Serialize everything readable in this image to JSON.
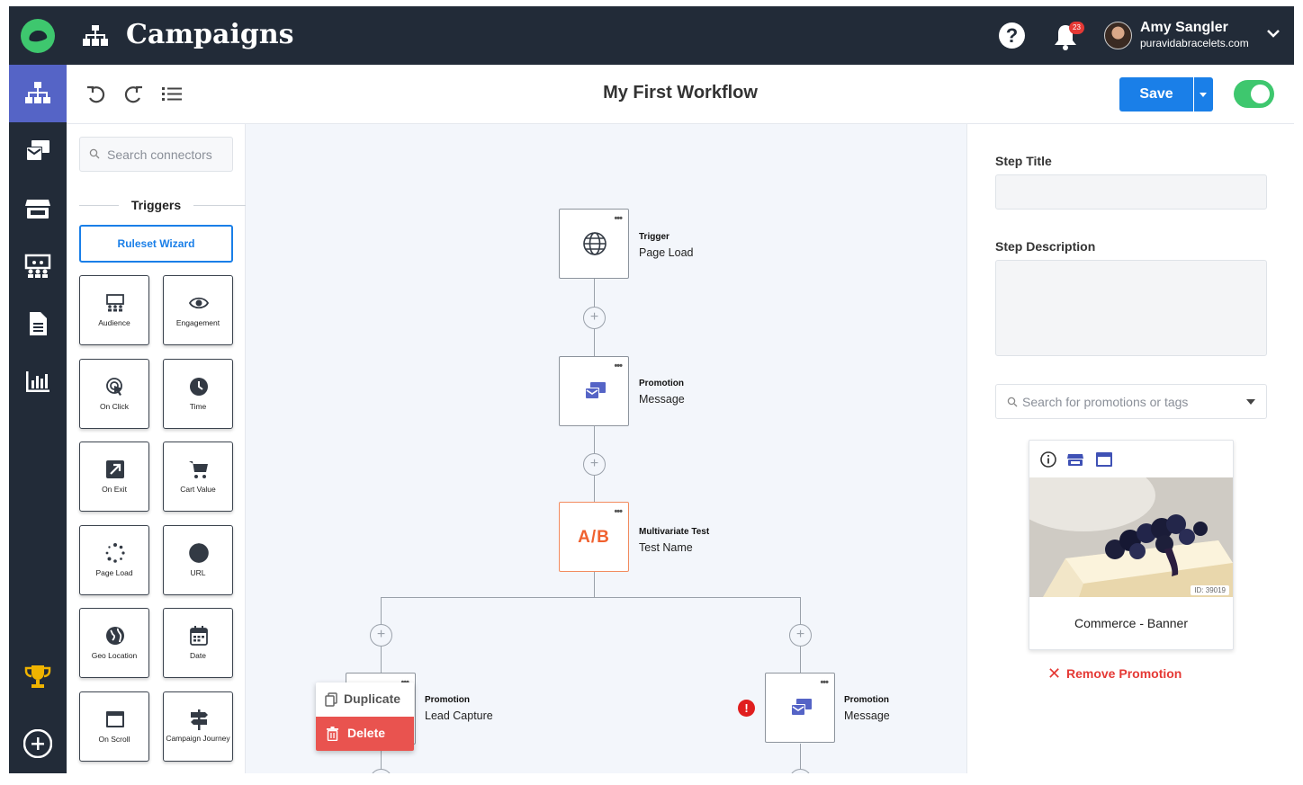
{
  "header": {
    "app_title": "Campaigns",
    "notification_count": "23",
    "user_name": "Amy Sangler",
    "user_domain": "puravidabracelets.com",
    "help_glyph": "?"
  },
  "rail": {
    "items": [
      "workflow-icon",
      "promotions-icon",
      "store-icon",
      "audience-icon",
      "document-icon",
      "analytics-icon"
    ],
    "bottom": [
      "trophy-icon",
      "add-circle-icon"
    ]
  },
  "toolbar": {
    "workflow_title": "My First Workflow",
    "save_label": "Save",
    "enabled": true
  },
  "connectors": {
    "search_placeholder": "Search connectors",
    "section_title": "Triggers",
    "wizard_label": "Ruleset Wizard",
    "tiles": [
      {
        "label": "Audience",
        "icon": "audience-icon"
      },
      {
        "label": "Engagement",
        "icon": "eye-icon"
      },
      {
        "label": "On Click",
        "icon": "click-icon"
      },
      {
        "label": "Time",
        "icon": "clock-icon"
      },
      {
        "label": "On Exit",
        "icon": "exit-icon"
      },
      {
        "label": "Cart Value",
        "icon": "cart-icon"
      },
      {
        "label": "Page Load",
        "icon": "loading-icon"
      },
      {
        "label": "URL",
        "icon": "globe-icon"
      },
      {
        "label": "Geo Location",
        "icon": "geo-icon"
      },
      {
        "label": "Date",
        "icon": "calendar-icon"
      },
      {
        "label": "On Scroll",
        "icon": "scroll-icon"
      },
      {
        "label": "Campaign Journey",
        "icon": "signpost-icon"
      }
    ]
  },
  "canvas": {
    "nodes": [
      {
        "type": "Trigger",
        "name": "Page Load"
      },
      {
        "type": "Promotion",
        "name": "Message"
      },
      {
        "type": "Multivariate Test",
        "name": "Test Name",
        "badge": "A/B"
      },
      {
        "type": "Promotion",
        "name": "Lead Capture"
      },
      {
        "type": "Promotion",
        "name": "Message"
      }
    ],
    "menu_dots": "•••",
    "plus_glyph": "+",
    "error_glyph": "!",
    "context_menu": {
      "duplicate": "Duplicate",
      "delete": "Delete"
    }
  },
  "details": {
    "step_title_label": "Step Title",
    "step_title_value": "",
    "step_description_label": "Step Description",
    "step_description_value": "",
    "promo_search_placeholder": "Search for promotions or tags",
    "promo_card": {
      "id_tag": "ID: 39019",
      "name": "Commerce - Banner"
    },
    "remove_label": "Remove Promotion"
  },
  "colors": {
    "dark": "#222b38",
    "accent": "#1a7fe8",
    "active_rail": "#5564c6",
    "toggle_on": "#3ec76e",
    "ab_orange": "#f0612f",
    "danger": "#e9534f"
  }
}
